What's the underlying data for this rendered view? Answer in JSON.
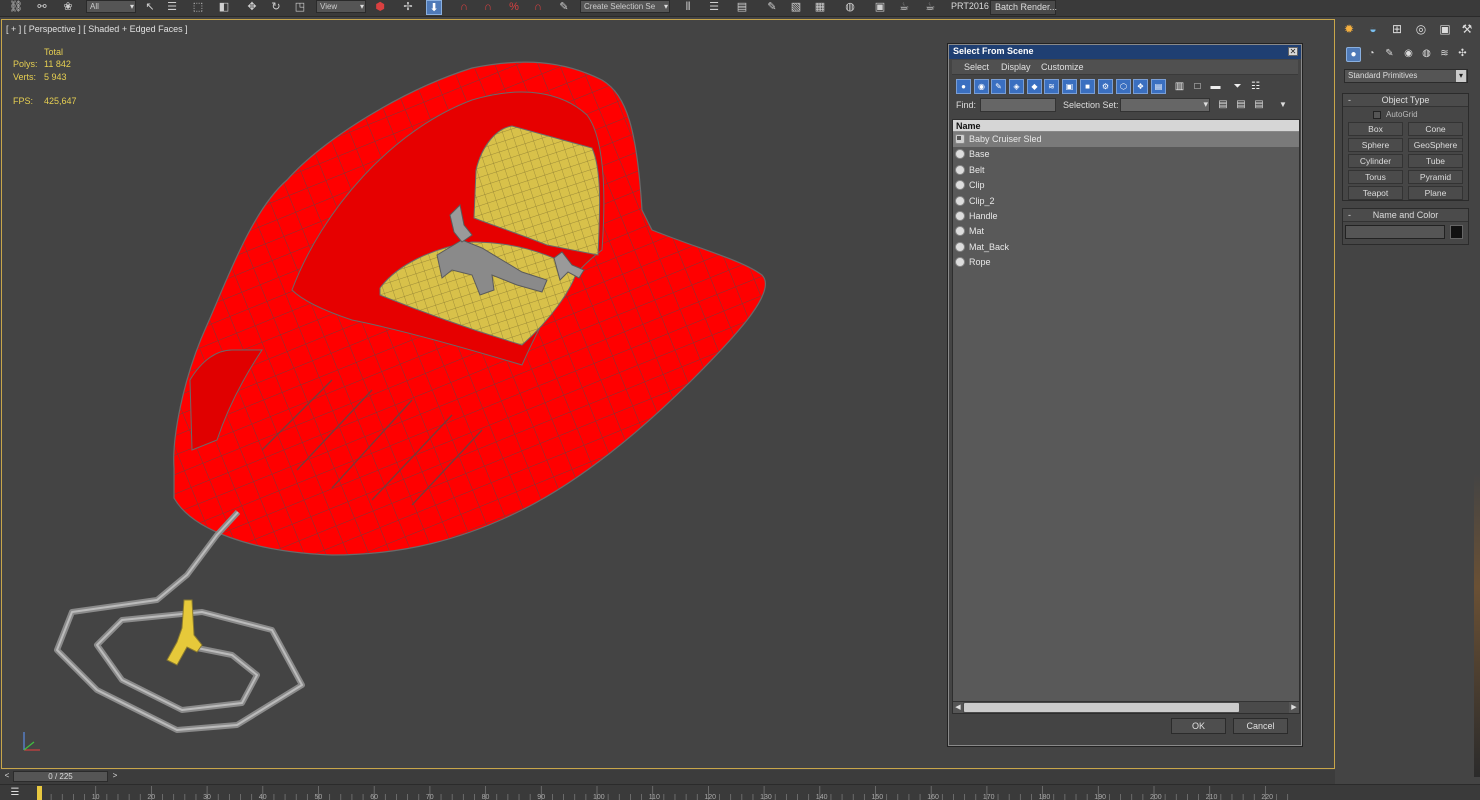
{
  "toolbar": {
    "combo_filter": "All",
    "combo_view": "View",
    "combo_selection": "Create Selection Se",
    "prt_label": "PRT2016",
    "batch_render_label": "Batch Render..."
  },
  "viewport": {
    "label": "[ + ] [ Perspective ] [ Shaded + Edged Faces ]",
    "stats": {
      "total_label": "Total",
      "polys_label": "Polys:",
      "polys_value": "11 842",
      "verts_label": "Verts:",
      "verts_value": "5 943",
      "fps_label": "FPS:",
      "fps_value": "425,647"
    }
  },
  "dialog": {
    "title": "Select From Scene",
    "menu": [
      "Select",
      "Display",
      "Customize"
    ],
    "find_label": "Find:",
    "find_value": "",
    "selection_set_label": "Selection Set:",
    "column_name": "Name",
    "items": [
      {
        "name": "Baby Cruiser Sled",
        "type": "group",
        "selected": true
      },
      {
        "name": "Base",
        "type": "object",
        "selected": false
      },
      {
        "name": "Belt",
        "type": "object",
        "selected": false
      },
      {
        "name": "Clip",
        "type": "object",
        "selected": false
      },
      {
        "name": "Clip_2",
        "type": "object",
        "selected": false
      },
      {
        "name": "Handle",
        "type": "object",
        "selected": false
      },
      {
        "name": "Mat",
        "type": "object",
        "selected": false
      },
      {
        "name": "Mat_Back",
        "type": "object",
        "selected": false
      },
      {
        "name": "Rope",
        "type": "object",
        "selected": false
      }
    ],
    "ok_label": "OK",
    "cancel_label": "Cancel"
  },
  "command_panel": {
    "primitive_type": "Standard Primitives",
    "object_type_title": "Object Type",
    "autogrid_label": "AutoGrid",
    "autogrid_checked": false,
    "primitives": [
      "Box",
      "Cone",
      "Sphere",
      "GeoSphere",
      "Cylinder",
      "Tube",
      "Torus",
      "Pyramid",
      "Teapot",
      "Plane"
    ],
    "name_color_title": "Name and Color",
    "object_name": "",
    "object_color": "#111111"
  },
  "timeline": {
    "slider_label": "0 / 225",
    "frame_start": 0,
    "frame_end": 225,
    "ruler_labels": [
      "10",
      "20",
      "30",
      "40",
      "50",
      "60",
      "70",
      "80",
      "90",
      "100",
      "110",
      "120",
      "130",
      "140",
      "150",
      "160",
      "170",
      "180",
      "190",
      "200",
      "210",
      "220"
    ]
  },
  "colors": {
    "sled_red": "#ff0000",
    "mat_yellow": "#d8c14a",
    "selection_blue": "#1f3f72",
    "viewport_border": "#c8a64a",
    "stats_yellow": "#e6cf52"
  }
}
